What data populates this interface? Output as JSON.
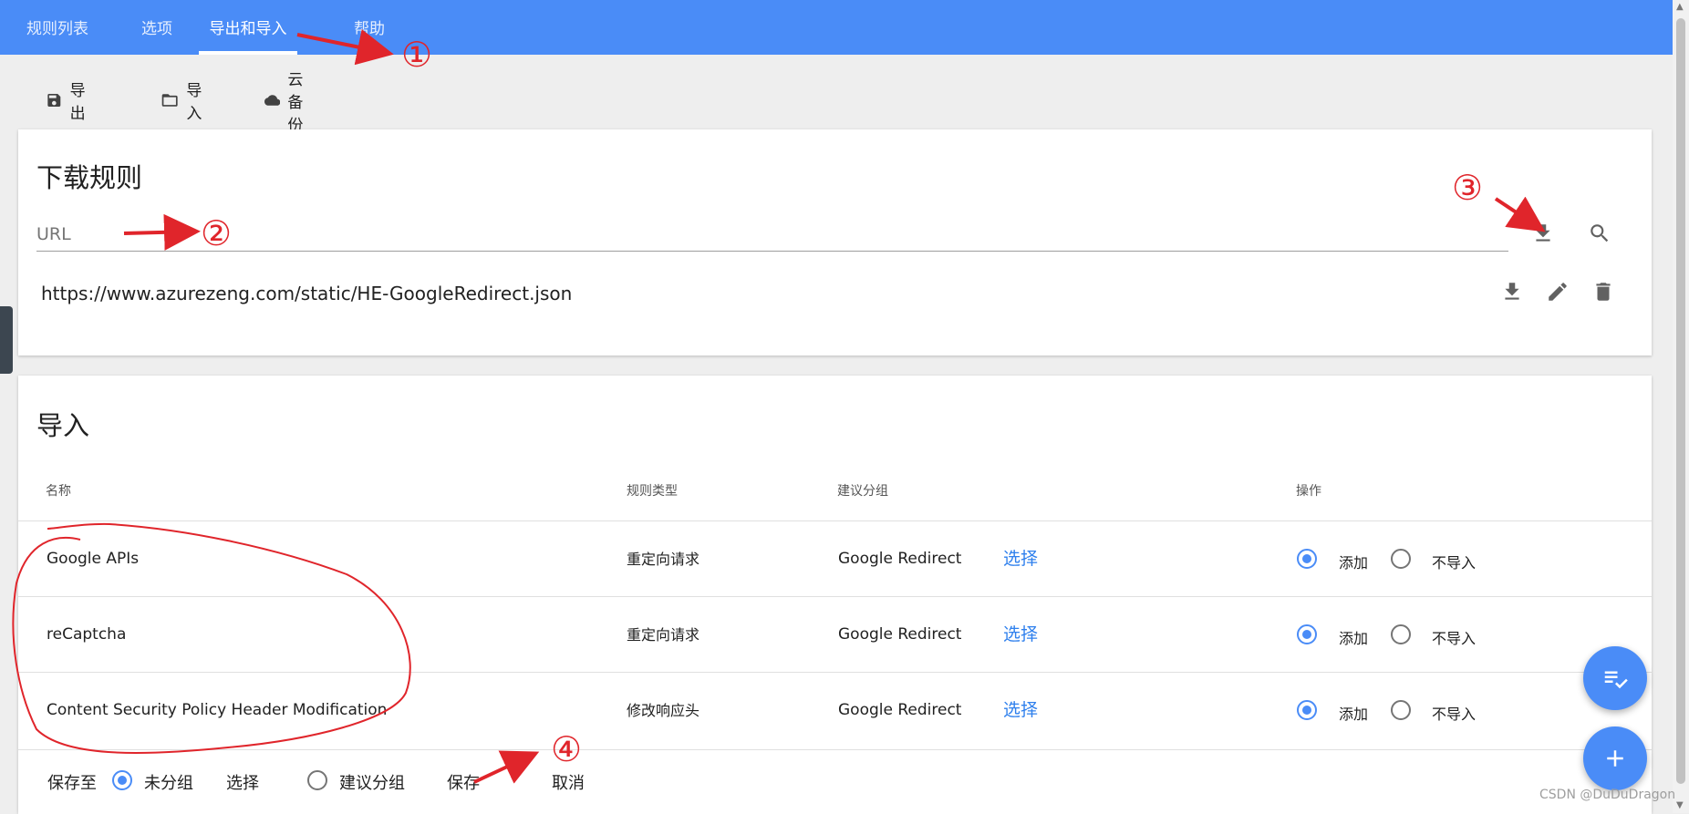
{
  "tabs": [
    {
      "label": "规则列表",
      "active": false
    },
    {
      "label": "选项",
      "active": false
    },
    {
      "label": "导出和导入",
      "active": true
    },
    {
      "label": "帮助",
      "active": false
    }
  ],
  "actions": {
    "export_label": "导出",
    "import_label": "导入",
    "cloud_label": "云备份"
  },
  "download_card": {
    "title": "下载规则",
    "url_placeholder": "URL",
    "rules": [
      "https://www.azurezeng.com/static/HE-GoogleRedirect.json"
    ]
  },
  "import_card": {
    "title": "导入",
    "columns": {
      "name": "名称",
      "type": "规则类型",
      "group": "建议分组",
      "ops": "操作"
    },
    "rows": [
      {
        "name": "Google APIs",
        "type": "重定向请求",
        "group": "Google Redirect",
        "choose": "选择",
        "add": "添加",
        "skip": "不导入",
        "selected": "add"
      },
      {
        "name": "reCaptcha",
        "type": "重定向请求",
        "group": "Google Redirect",
        "choose": "选择",
        "add": "添加",
        "skip": "不导入",
        "selected": "add"
      },
      {
        "name": "Content Security Policy Header Modification",
        "type": "修改响应头",
        "group": "Google Redirect",
        "choose": "选择",
        "add": "添加",
        "skip": "不导入",
        "selected": "add"
      }
    ],
    "footer": {
      "save_to": "保存至",
      "ungrouped": "未分组",
      "choose": "选择",
      "suggested_group": "建议分组",
      "save": "保存",
      "cancel": "取消",
      "selected": "ungrouped"
    }
  },
  "annotations": [
    "①",
    "②",
    "③",
    "④"
  ],
  "watermark": "CSDN @DuDuDragon",
  "colors": {
    "primary": "#4a8cf7",
    "link": "#2f80ed",
    "annotation": "#e0252b"
  }
}
